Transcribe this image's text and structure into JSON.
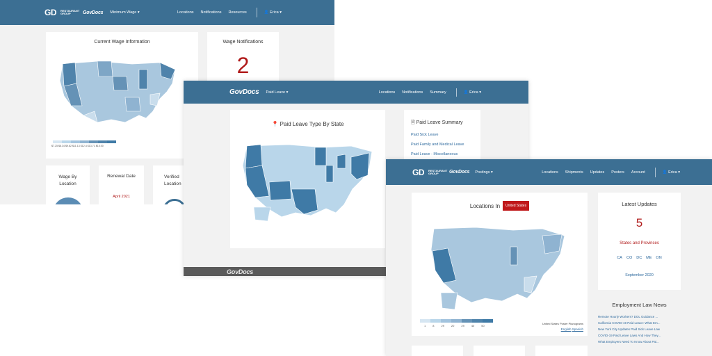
{
  "shot1": {
    "brand": "GD",
    "brand_sub": "RESTAURANT GROUP",
    "logo": "GovDocs",
    "menu": "Minimum Wage",
    "nav": [
      "Locations",
      "Notifications",
      "Resources"
    ],
    "user": "Erica",
    "cards": {
      "current_wage": "Current Wage Information",
      "wage_notifications": "Wage Notifications",
      "notification_count": "2",
      "wage_by_location": "Wage By Location",
      "renewal_date": "Renewal Date",
      "renewal_value": "April 2021",
      "verified": "Verified Location"
    },
    "legend_labels": [
      "$7.25",
      "$8.34",
      "$9.82",
      "$11.13",
      "$12.4",
      "$13.71",
      "$15.00"
    ]
  },
  "shot2": {
    "logo": "GovDocs",
    "menu": "Paid Leave",
    "nav": [
      "Locations",
      "Notifications",
      "Summary"
    ],
    "user": "Erica",
    "map_title": "Paid Leave Type By State",
    "summary_title": "Paid Leave Summary",
    "summary_links": [
      "Paid Sick Leave",
      "Paid Family and Medical Leave",
      "Paid Leave - Miscellaneous"
    ],
    "footer_logo": "GovDocs"
  },
  "shot3": {
    "brand": "GD",
    "brand_sub": "RESTAURANT GROUP",
    "logo": "GovDocs",
    "menu": "Postings",
    "nav": [
      "Locations",
      "Shipments",
      "Updates",
      "Posters",
      "Account"
    ],
    "user": "Erica",
    "locations_in": "Locations In",
    "country": "United States",
    "legend_labels": [
      "1",
      "8",
      "29",
      "20",
      "29",
      "40",
      "50"
    ],
    "poster_caption": "United States Poster Planograms",
    "lang_english": "English",
    "lang_spanish": "Spanish",
    "latest_updates": "Latest Updates",
    "update_count": "5",
    "states_provinces": "States and Provinces",
    "codes": [
      "CA",
      "CO",
      "DC",
      "ME",
      "ON"
    ],
    "update_month": "September 2020",
    "news_title": "Employment Law News",
    "news": [
      "Remote Hourly Workers? DOL Guidance ...",
      "California COVID-19 Paid Leave: What Em...",
      "New York City Updates Paid Sick Leave Law",
      "COVID-19 Paid Leave Laws And How They...",
      "What Employers Need To Know About Pai..."
    ]
  },
  "colors": {
    "nav": "#3c6f93",
    "map_light": "#b9d6ea",
    "map_mid": "#8fb3d1",
    "map_dark": "#3f7aa6",
    "accent_red": "#b01a1a"
  }
}
